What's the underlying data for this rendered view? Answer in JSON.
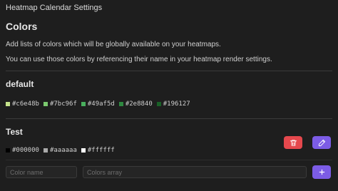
{
  "header": {
    "title": "Heatmap Calendar Settings"
  },
  "colors_section": {
    "heading": "Colors",
    "description_1": "Add lists of colors which will be globally available on your heatmaps.",
    "description_2": "You can use those colors by referencing their name in your heatmap render settings."
  },
  "palettes": [
    {
      "name": "default",
      "colors": [
        {
          "hex": "#c6e48b",
          "label": "#c6e48b"
        },
        {
          "hex": "#7bc96f",
          "label": "#7bc96f"
        },
        {
          "hex": "#49af5d",
          "label": "#49af5d"
        },
        {
          "hex": "#2e8840",
          "label": "#2e8840"
        },
        {
          "hex": "#196127",
          "label": "#196127"
        }
      ]
    },
    {
      "name": "Test",
      "colors": [
        {
          "hex": "#000000",
          "label": "#000000"
        },
        {
          "hex": "#aaaaaa",
          "label": "#aaaaaa"
        },
        {
          "hex": "#ffffff",
          "label": "#ffffff"
        }
      ],
      "actions": {
        "delete_icon": "trash-icon",
        "edit_icon": "pencil-icon"
      }
    }
  ],
  "new_palette": {
    "name_placeholder": "Color name",
    "array_placeholder": "Colors array",
    "add_icon": "plus-icon"
  },
  "accent": {
    "danger": "#e5484d",
    "primary": "#7c5ce6"
  }
}
